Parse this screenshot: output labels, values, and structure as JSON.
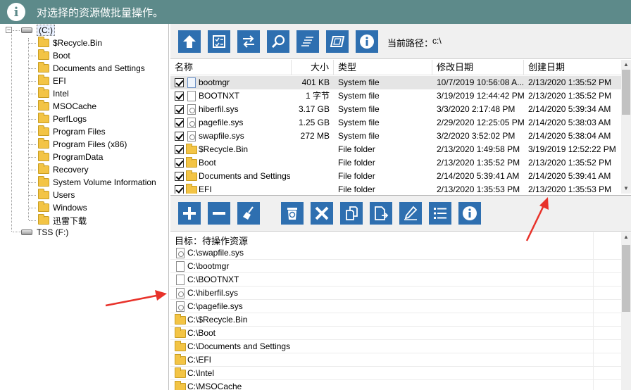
{
  "title": {
    "text": "对选择的资源做批量操作。"
  },
  "tree": {
    "root": "(C:)",
    "children": [
      "$Recycle.Bin",
      "Boot",
      "Documents and Settings",
      "EFI",
      "Intel",
      "MSOCache",
      "PerfLogs",
      "Program Files",
      "Program Files (x86)",
      "ProgramData",
      "Recovery",
      "System Volume Information",
      "Users",
      "Windows",
      "迅雷下载"
    ],
    "second_drive": "TSS (F:)"
  },
  "toolbar1": {
    "buttons": [
      "up-arrow-icon",
      "select-icon",
      "swap-icon",
      "search-icon",
      "list-lines-icon",
      "frame-icon",
      "info-icon"
    ],
    "path_label": "当前路径：",
    "path_value": "c:\\"
  },
  "table1": {
    "columns": [
      "名称",
      "大小",
      "类型",
      "修改日期",
      "创建日期"
    ],
    "rows": [
      {
        "name": "bootmgr",
        "size": "401 KB",
        "type": "System file",
        "modified": "10/7/2019 10:56:08 A...",
        "created": "2/13/2020 1:35:52 PM",
        "icon": "file",
        "selected": true
      },
      {
        "name": "BOOTNXT",
        "size": "1 字节",
        "type": "System file",
        "modified": "3/19/2019 12:44:42 PM",
        "created": "2/13/2020 1:35:52 PM",
        "icon": "file",
        "selected": false
      },
      {
        "name": "hiberfil.sys",
        "size": "3.17 GB",
        "type": "System file",
        "modified": "3/3/2020 2:17:48 PM",
        "created": "2/14/2020 5:39:34 AM",
        "icon": "sys",
        "selected": false
      },
      {
        "name": "pagefile.sys",
        "size": "1.25 GB",
        "type": "System file",
        "modified": "2/29/2020 12:25:05 PM",
        "created": "2/14/2020 5:38:03 AM",
        "icon": "sys",
        "selected": false
      },
      {
        "name": "swapfile.sys",
        "size": "272 MB",
        "type": "System file",
        "modified": "3/2/2020 3:52:02 PM",
        "created": "2/14/2020 5:38:04 AM",
        "icon": "sys",
        "selected": false
      },
      {
        "name": "$Recycle.Bin",
        "size": "",
        "type": "File folder",
        "modified": "2/13/2020 1:49:58 PM",
        "created": "3/19/2019 12:52:22 PM",
        "icon": "folder",
        "selected": false
      },
      {
        "name": "Boot",
        "size": "",
        "type": "File folder",
        "modified": "2/13/2020 1:35:52 PM",
        "created": "2/13/2020 1:35:52 PM",
        "icon": "folder",
        "selected": false
      },
      {
        "name": "Documents and Settings",
        "size": "",
        "type": "File folder",
        "modified": "2/14/2020 5:39:41 AM",
        "created": "2/14/2020 5:39:41 AM",
        "icon": "folder",
        "selected": false
      },
      {
        "name": "EFI",
        "size": "",
        "type": "File folder",
        "modified": "2/13/2020 1:35:53 PM",
        "created": "2/13/2020 1:35:53 PM",
        "icon": "folder",
        "selected": false
      }
    ]
  },
  "toolbar2": {
    "buttons": [
      "plus-icon",
      "minus-icon",
      "broom-icon",
      "recycle-bin-icon",
      "delete-x-icon",
      "copy-icon",
      "move-icon",
      "rename-pen-icon",
      "list-bullets-icon",
      "info-icon"
    ]
  },
  "table2": {
    "header": "目标：待操作资源",
    "rows": [
      {
        "path": "C:\\swapfile.sys",
        "icon": "sys"
      },
      {
        "path": "C:\\bootmgr",
        "icon": "file"
      },
      {
        "path": "C:\\BOOTNXT",
        "icon": "file"
      },
      {
        "path": "C:\\hiberfil.sys",
        "icon": "sys"
      },
      {
        "path": "C:\\pagefile.sys",
        "icon": "sys"
      },
      {
        "path": "C:\\$Recycle.Bin",
        "icon": "folder"
      },
      {
        "path": "C:\\Boot",
        "icon": "folder"
      },
      {
        "path": "C:\\Documents and Settings",
        "icon": "folder"
      },
      {
        "path": "C:\\EFI",
        "icon": "folder"
      },
      {
        "path": "C:\\Intel",
        "icon": "folder"
      },
      {
        "path": "C:\\MSOCache",
        "icon": "folder"
      }
    ]
  },
  "colors": {
    "titlebar": "#5d8a8a",
    "button": "#2e6fb0",
    "annotation_arrow": "#e8322a"
  }
}
